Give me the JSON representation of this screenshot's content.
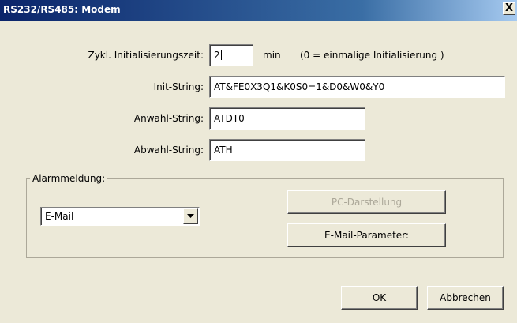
{
  "window": {
    "title": "RS232/RS485: Modem",
    "close_glyph": "X"
  },
  "fields": {
    "init_time": {
      "label": "Zykl. Initialisierungszeit:",
      "value": "2",
      "unit": "min",
      "note": "(0 = einmalige Initialisierung )"
    },
    "init_string": {
      "label": "Init-String:",
      "value": "AT&FE0X3Q1&K0S0=1&D0&W0&Y0"
    },
    "dial_string": {
      "label": "Anwahl-String:",
      "value": "ATDT0"
    },
    "hangup_string": {
      "label": "Abwahl-String:",
      "value": "ATH"
    }
  },
  "alarm": {
    "group_label": "Alarmmeldung:",
    "selected": "E-Mail",
    "pc_button": "PC-Darstellung",
    "email_button": "E-Mail-Parameter:"
  },
  "footer": {
    "ok": "OK",
    "cancel_pre": "Abbre",
    "cancel_hotkey": "c",
    "cancel_post": "hen"
  },
  "colors": {
    "dialog_bg": "#ece9d8",
    "titlebar_start": "#0a246a",
    "titlebar_end": "#a6caf0",
    "disabled_text": "#aca899"
  }
}
